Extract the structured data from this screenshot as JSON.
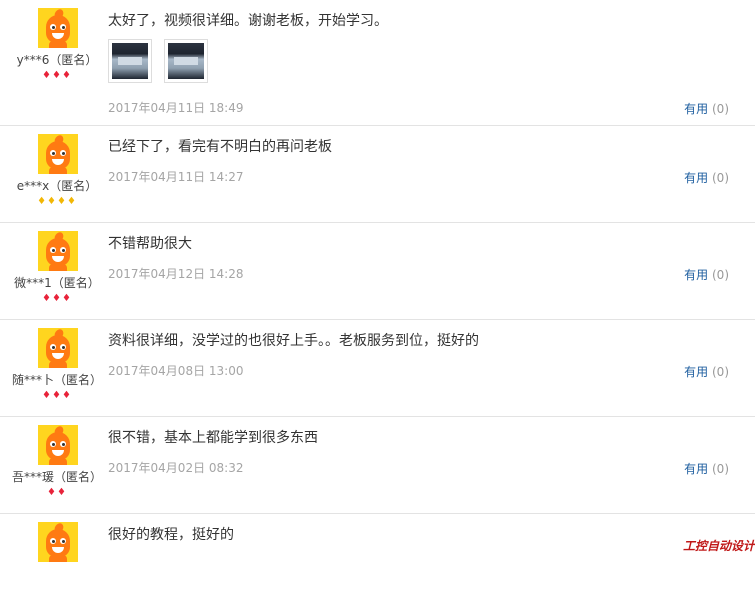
{
  "reviews": [
    {
      "username": "y***6（匿名）",
      "level_badges": "♦♦♦",
      "level_color": "#e8233a",
      "content": "太好了，视频很详细。谢谢老板，开始学习。",
      "date": "2017年04月11日 18:49",
      "useful_label": "有用",
      "useful_count": "(0)"
    },
    {
      "username": "e***x（匿名）",
      "level_badges": "♦♦♦♦",
      "level_color": "#f2b705",
      "content": "已经下了，看完有不明白的再问老板",
      "date": "2017年04月11日 14:27",
      "useful_label": "有用",
      "useful_count": "(0)"
    },
    {
      "username": "微***1（匿名）",
      "level_badges": "♦♦♦",
      "level_color": "#e8233a",
      "content": "不错帮助很大",
      "date": "2017年04月12日 14:28",
      "useful_label": "有用",
      "useful_count": "(0)"
    },
    {
      "username": "随***卜（匿名）",
      "level_badges": "♦♦♦",
      "level_color": "#e8233a",
      "content": "资料很详细，没学过的也很好上手。。老板服务到位，挺好的",
      "date": "2017年04月08日 13:00",
      "useful_label": "有用",
      "useful_count": "(0)"
    },
    {
      "username": "吾***瑗（匿名）",
      "level_badges": "♦♦",
      "level_color": "#e8233a",
      "content": "很不错，基本上都能学到很多东西",
      "date": "2017年04月02日 08:32",
      "useful_label": "有用",
      "useful_count": "(0)"
    },
    {
      "content": "很好的教程，挺好的"
    }
  ],
  "watermark": "工控自动设计"
}
